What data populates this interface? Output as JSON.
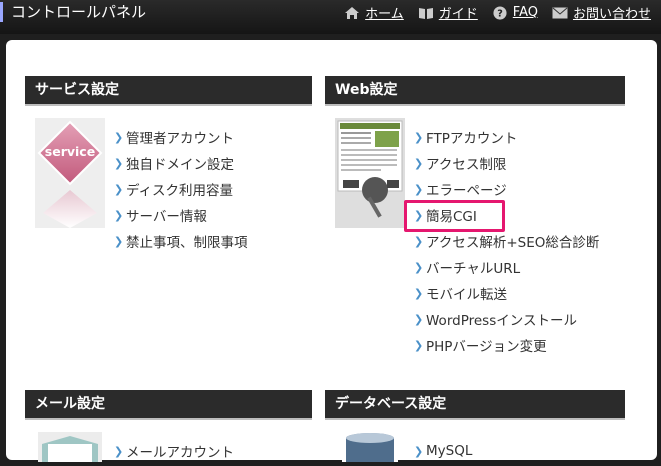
{
  "header": {
    "title": "コントロールパネル",
    "nav": [
      {
        "label": "ホーム",
        "icon": "home-icon"
      },
      {
        "label": "ガイド",
        "icon": "book-icon"
      },
      {
        "label": "FAQ",
        "icon": "question-icon"
      },
      {
        "label": "お問い合わせ",
        "icon": "mail-icon"
      }
    ]
  },
  "service": {
    "title": "サービス設定",
    "badge": "service",
    "items": [
      "管理者アカウント",
      "独自ドメイン設定",
      "ディスク利用容量",
      "サーバー情報",
      "禁止事項、制限事項"
    ]
  },
  "web": {
    "title": "Web設定",
    "items": [
      "FTPアカウント",
      "アクセス制限",
      "エラーページ",
      "簡易CGI",
      "アクセス解析+SEO総合診断",
      "バーチャルURL",
      "モバイル転送",
      "WordPressインストール",
      "PHPバージョン変更"
    ],
    "highlighted_item": "簡易CGI"
  },
  "mail": {
    "title": "メール設定",
    "first_item": "メールアカウント"
  },
  "database": {
    "title": "データベース設定",
    "first_item": "MySQL"
  },
  "colors": {
    "highlight": "#e5176f",
    "header_bg": "#2b2b2b",
    "arrow": "#4a90c8"
  }
}
